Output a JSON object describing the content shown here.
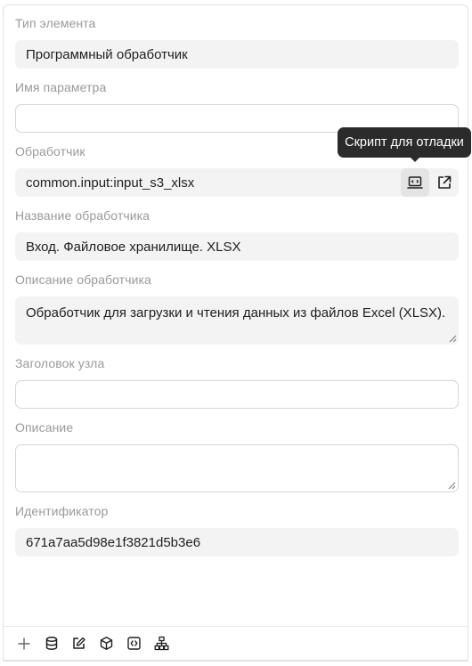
{
  "form": {
    "element_type": {
      "label": "Тип элемента",
      "value": "Программный обработчик"
    },
    "param_name": {
      "label": "Имя параметра",
      "value": ""
    },
    "handler": {
      "label": "Обработчик",
      "value": "common.input:input_s3_xlsx"
    },
    "handler_name": {
      "label": "Название обработчика",
      "value": "Вход. Файловое хранилище. XLSX"
    },
    "handler_desc": {
      "label": "Описание обработчика",
      "value": "Обработчик для загрузки и чтения данных из файлов Excel (XLSX)."
    },
    "node_title": {
      "label": "Заголовок узла",
      "value": ""
    },
    "description": {
      "label": "Описание",
      "value": ""
    },
    "identifier": {
      "label": "Идентификатор",
      "value": "671a7aa5d98e1f3821d5b3e6"
    }
  },
  "tooltip": {
    "text": "Скрипт для отладки"
  },
  "handler_actions": [
    "debug-script-icon",
    "open-external-icon"
  ],
  "toolbar": [
    "add-icon",
    "database-icon",
    "edit-icon",
    "cube-icon",
    "code-icon",
    "hierarchy-icon"
  ]
}
